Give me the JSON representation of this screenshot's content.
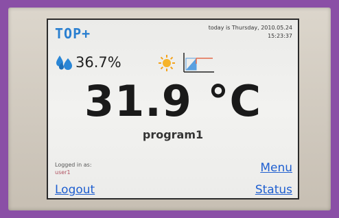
{
  "device": {
    "brand": "TOP+",
    "date_line": "today is Thursday, 2010.05.24",
    "time": "15:23:37",
    "humidity": "36.7%",
    "temperature": "31.9 °C",
    "program": "program1",
    "logged_in_label": "Logged in as:",
    "user": "user1",
    "menu_label": "Menu",
    "status_label": "Status",
    "logout_label": "Logout",
    "icons": [
      "water-drops-icon",
      "sun-icon",
      "program-graph-icon"
    ],
    "colors": {
      "accent": "#2a7fd0",
      "link": "#1f5fd0",
      "frame": "#8a4fa6",
      "sun": "#f4a21a"
    }
  }
}
